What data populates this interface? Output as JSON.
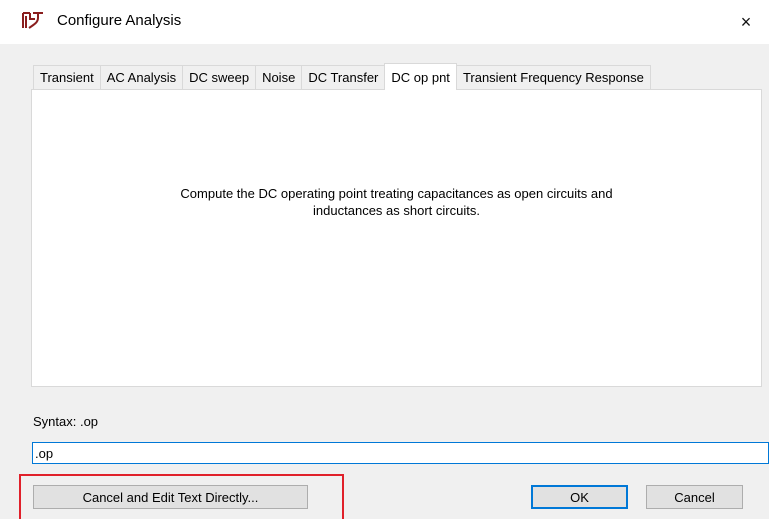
{
  "window": {
    "title": "Configure Analysis",
    "close_glyph": "×",
    "icon": "ltspice-icon"
  },
  "tabs": [
    {
      "label": "Transient",
      "active": false
    },
    {
      "label": "AC Analysis",
      "active": false
    },
    {
      "label": "DC sweep",
      "active": false
    },
    {
      "label": "Noise",
      "active": false
    },
    {
      "label": "DC Transfer",
      "active": false
    },
    {
      "label": "DC op pnt",
      "active": true
    },
    {
      "label": "Transient Frequency Response",
      "active": false
    }
  ],
  "panel": {
    "description_line1": "Compute the DC operating point treating capacitances as open circuits and",
    "description_line2": "inductances as short circuits."
  },
  "syntax": {
    "label": "Syntax: .op",
    "value": ".op"
  },
  "buttons": {
    "edit_text": "Cancel and Edit Text Directly...",
    "ok": "OK",
    "cancel": "Cancel"
  },
  "colors": {
    "highlight": "#e0202a",
    "focus": "#0078d7"
  }
}
